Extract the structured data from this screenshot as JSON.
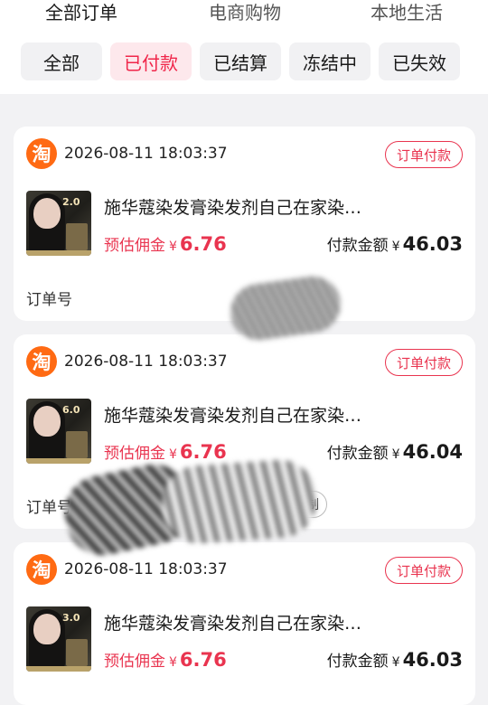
{
  "top_tabs": [
    {
      "label": "全部订单",
      "active": true
    },
    {
      "label": "电商购物",
      "active": false
    },
    {
      "label": "本地生活",
      "active": false
    }
  ],
  "filter_chips": [
    {
      "label": "全部",
      "active": false
    },
    {
      "label": "已付款",
      "active": true
    },
    {
      "label": "已结算",
      "active": false
    },
    {
      "label": "冻结中",
      "active": false
    },
    {
      "label": "已失效",
      "active": false
    }
  ],
  "colors": {
    "accent": "#f0264a",
    "taobao_orange": "#ff6a13"
  },
  "shop_icon": {
    "glyph": "淘",
    "name": "taobao-icon"
  },
  "orders": [
    {
      "time": "2026-08-11 18:03:37",
      "status": "订单付款",
      "title": "施华蔻染发膏染发剂自己在家染…",
      "commission_label": "预估佣金",
      "commission_currency": "¥",
      "commission_value": "6.76",
      "payment_label": "付款金额",
      "payment_currency": "¥",
      "payment_value": "46.03",
      "order_no_label": "订单号",
      "thumb_badge": "2.0"
    },
    {
      "time": "2026-08-11 18:03:37",
      "status": "订单付款",
      "title": "施华蔻染发膏染发剂自己在家染…",
      "commission_label": "预估佣金",
      "commission_currency": "¥",
      "commission_value": "6.76",
      "payment_label": "付款金额",
      "payment_currency": "¥",
      "payment_value": "46.04",
      "order_no_label": "订单号",
      "copy_label": "制",
      "thumb_badge": "6.0"
    },
    {
      "time": "2026-08-11 18:03:37",
      "status": "订单付款",
      "title": "施华蔻染发膏染发剂自己在家染…",
      "commission_label": "预估佣金",
      "commission_currency": "¥",
      "commission_value": "6.76",
      "payment_label": "付款金额",
      "payment_currency": "¥",
      "payment_value": "46.03",
      "thumb_badge": "3.0"
    }
  ]
}
